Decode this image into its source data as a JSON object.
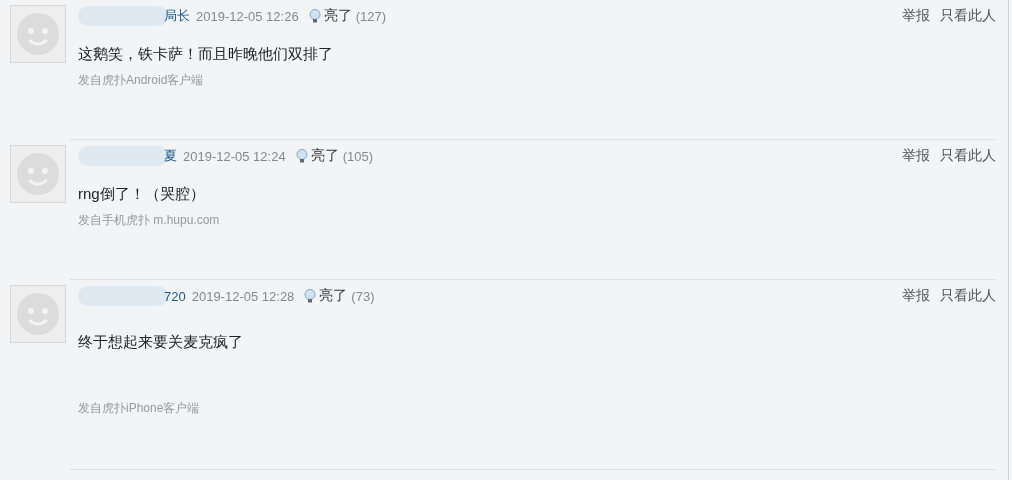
{
  "replies": [
    {
      "user": "局长",
      "time": "2019-12-05 12:26",
      "light_label": "亮了",
      "light_count": "(127)",
      "text": "这鹅笑，铁卡萨！而且昨晚他们双排了",
      "source": "发自虎扑Android客户端",
      "actions": [
        "举报",
        "只看此人"
      ]
    },
    {
      "user": "夏",
      "time": "2019-12-05 12:24",
      "light_label": "亮了",
      "light_count": "(105)",
      "text": "rng倒了！（哭腔）",
      "source": "发自手机虎扑 m.hupu.com",
      "actions": [
        "举报",
        "只看此人"
      ]
    },
    {
      "user": "720",
      "time": "2019-12-05 12:28",
      "light_label": "亮了",
      "light_count": "(73)",
      "text": "终于想起来要关麦克疯了",
      "source": "发自虎扑iPhone客户端",
      "actions": [
        "举报",
        "只看此人"
      ]
    }
  ]
}
